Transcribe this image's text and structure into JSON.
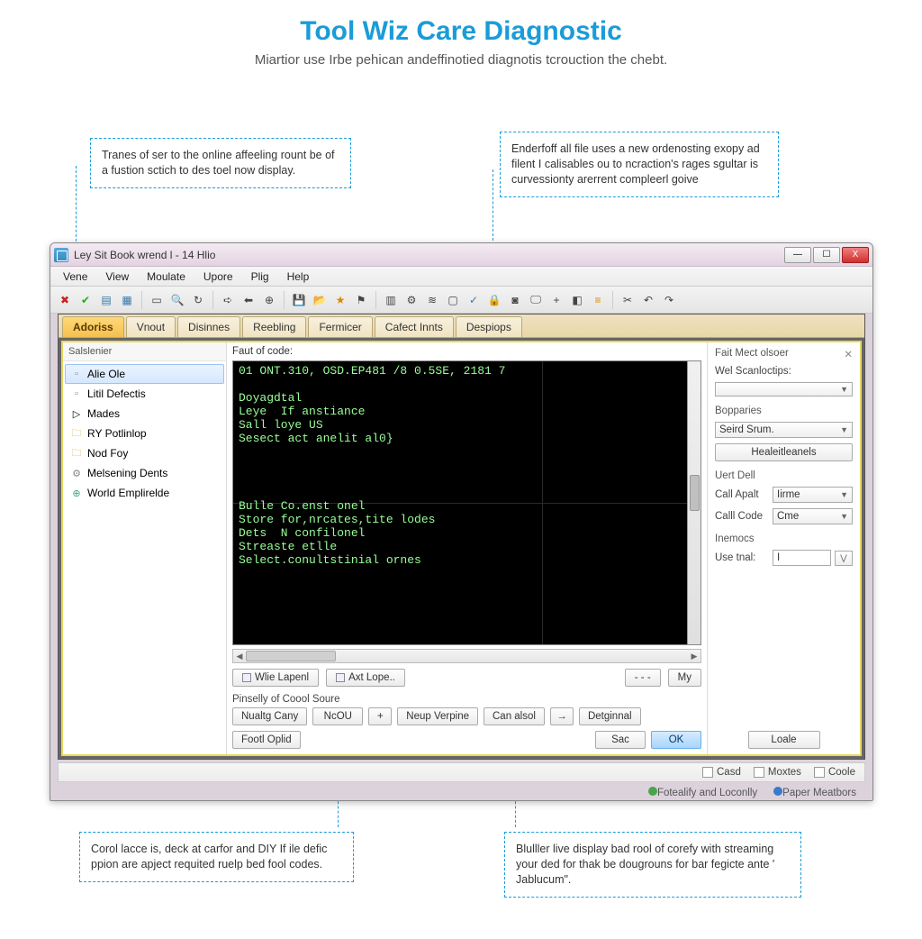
{
  "page": {
    "title": "Tool Wiz Care Diagnostic",
    "subtitle": "Miartior use Irbe pehican andeffinotied diagnotis tcrouction the chebt."
  },
  "callouts": {
    "c1": "Tranes of ser to the online affeeling rount be of a fustion sctich to des toel now display.",
    "c2": "Enderfoff all file uses a new ordenosting exopy ad filent I calisables ou to ncraction's rages sgultar is curvessionty arerrent compleerl goive",
    "c3": "Corol lacce is, deck at carfor and DIY If ile defic ppion are apject requited ruelp bed fool codes.",
    "c4": "Blulller live display bad rool of corefy with streaming your ded for thak be dougrouns for bar fegicte ante ' Jablucum\"."
  },
  "window": {
    "title": "Ley Sit Book wrend l - 14 Hlio",
    "buttons": {
      "min": "—",
      "max": "☐",
      "close": "X"
    }
  },
  "menu": [
    "Vene",
    "View",
    "Moulate",
    "Upore",
    "Plig",
    "Help"
  ],
  "tabs": [
    {
      "label": "Adoriss",
      "active": true
    },
    {
      "label": "Vnout"
    },
    {
      "label": "Disinnes"
    },
    {
      "label": "Reebling"
    },
    {
      "label": "Fermicer"
    },
    {
      "label": "Cafect Innts"
    },
    {
      "label": "Despiops"
    }
  ],
  "sidebar": {
    "header": "Salslenier",
    "items": [
      {
        "label": "Alie Ole",
        "icon": "doc",
        "selected": true
      },
      {
        "label": "Litil Defectis",
        "icon": "doc"
      },
      {
        "label": "Mades",
        "icon": "arrow"
      },
      {
        "label": "RY Potlinlop",
        "icon": "folder"
      },
      {
        "label": "Nod Foy",
        "icon": "folder"
      },
      {
        "label": "Melsening Dents",
        "icon": "gear"
      },
      {
        "label": "World Emplirelde",
        "icon": "globe"
      }
    ]
  },
  "code": {
    "heading": "Faut of code:",
    "lines": [
      "01 ONT.310, OSD.EP481 /8 0.5SE, 2181 7",
      "",
      "Doyagdtal",
      "Leye  If anstiance",
      "Sall loye US",
      "Sesect act anelit al0}",
      "",
      "",
      "",
      "",
      "Bulle Co.enst onel",
      "Store for,nrcates,tite lodes",
      "Dets  N confilonel",
      "Streaste etlle",
      "Select.conultstinial ornes"
    ]
  },
  "underConsole": {
    "b1": "Wlie Lapenl",
    "b2": "Axt Lope..",
    "dots": "- - -",
    "my": "My"
  },
  "source": {
    "label": "Pinselly of Coool Soure",
    "buttons": {
      "nualty": "Nualtg Cany",
      "ncou": "NcOU",
      "plus": "+",
      "neup": "Neup Verpine",
      "can": "Can alsol",
      "arrow": "→",
      "detg": "Detginnal",
      "foot": "Footl Oplid",
      "sac": "Sac",
      "ok": "OK"
    }
  },
  "props": {
    "title": "Fait Mect olsoer",
    "close": "✕",
    "scanLabel": "Wel Scanloctips:",
    "scanValue": "",
    "bopparies": "Bopparies",
    "seirdSrum": "Seird Srum.",
    "healei": "Healeitleanels",
    "uertDell": "Uert Dell",
    "callApalt": {
      "label": "Call Apalt",
      "value": "Iirme"
    },
    "callCode": {
      "label": "Calll Code",
      "value": "Cme"
    },
    "inemocs": "Inemocs",
    "useMal": {
      "label": "Use tnal:",
      "value": "I"
    },
    "loale": "Loale"
  },
  "status1": [
    {
      "icon": "☐",
      "label": "Casd"
    },
    {
      "icon": "☐",
      "label": "Moxtes"
    },
    {
      "icon": "☐",
      "label": "Coole"
    }
  ],
  "status2": [
    {
      "icon": "g",
      "label": "Fotealify and Loconlly"
    },
    {
      "icon": "b",
      "label": "Paper Meatbors"
    }
  ]
}
